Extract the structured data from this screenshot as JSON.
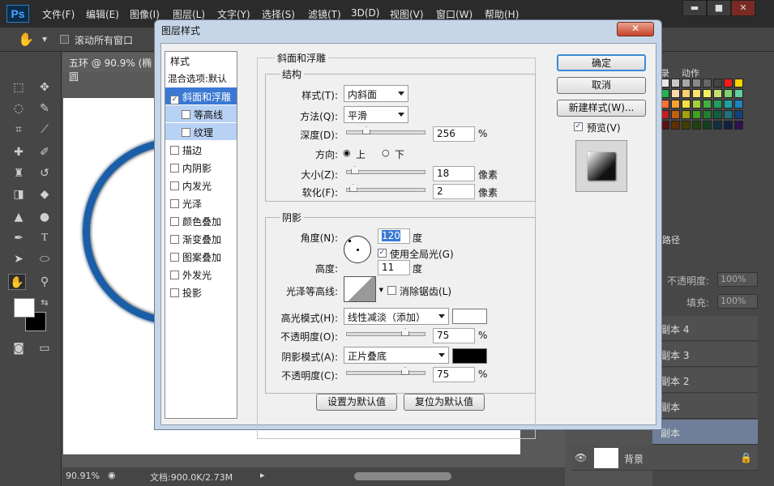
{
  "app": {
    "logo": "Ps",
    "menus": [
      "文件(F)",
      "编辑(E)",
      "图像(I)",
      "图层(L)",
      "文字(Y)",
      "选择(S)",
      "滤镜(T)",
      "3D(D)",
      "视图(V)",
      "窗口(W)",
      "帮助(H)"
    ],
    "window_buttons": [
      "▬",
      "■",
      "✕"
    ]
  },
  "options_bar": {
    "scroll_all": "滚动所有窗口"
  },
  "doc": {
    "tab": "五环 @ 90.9% (椭圆",
    "zoom": "90.91%",
    "doc_info": "文档:900.0K/2.73M"
  },
  "panels": {
    "tab_actions": "动作",
    "tab_record": "录",
    "tab_paths": "路径",
    "opacity_label": "不透明度:",
    "opacity_value": "100%",
    "fill_label": "填充:",
    "fill_value": "100%",
    "layers": [
      "副本 4",
      "副本 3",
      "副本 2",
      "副本",
      "副本",
      "背景"
    ]
  },
  "dialog": {
    "title": "图层样式",
    "close": "✕",
    "styles_header": "样式",
    "blend_options": "混合选项:默认",
    "style_items": [
      {
        "label": "斜面和浮雕",
        "checked": true
      },
      {
        "label": "等高线",
        "checked": false
      },
      {
        "label": "纹理",
        "checked": false
      },
      {
        "label": "描边",
        "checked": false
      },
      {
        "label": "内阴影",
        "checked": false
      },
      {
        "label": "内发光",
        "checked": false
      },
      {
        "label": "光泽",
        "checked": false
      },
      {
        "label": "颜色叠加",
        "checked": false
      },
      {
        "label": "渐变叠加",
        "checked": false
      },
      {
        "label": "图案叠加",
        "checked": false
      },
      {
        "label": "外发光",
        "checked": false
      },
      {
        "label": "投影",
        "checked": false
      }
    ],
    "bevel_title": "斜面和浮雕",
    "structure_title": "结构",
    "style_label": "样式(T):",
    "style_value": "内斜面",
    "method_label": "方法(Q):",
    "method_value": "平滑",
    "depth_label": "深度(D):",
    "depth_value": "256",
    "percent": "%",
    "direction_label": "方向:",
    "dir_up": "上",
    "dir_down": "下",
    "size_label": "大小(Z):",
    "size_value": "18",
    "px_unit": "像素",
    "soften_label": "软化(F):",
    "soften_value": "2",
    "shading_title": "阴影",
    "angle_label": "角度(N):",
    "angle_value": "120",
    "degree": "度",
    "global_light": "使用全局光(G)",
    "altitude_label": "高度:",
    "altitude_value": "11",
    "gloss_label": "光泽等高线:",
    "anti_alias": "消除锯齿(L)",
    "highlight_mode_label": "高光模式(H):",
    "highlight_mode_value": "线性减淡（添加）",
    "highlight_color": "#ffffff",
    "opacity_label": "不透明度(O):",
    "highlight_opacity": "75",
    "shadow_mode_label": "阴影模式(A):",
    "shadow_mode_value": "正片叠底",
    "shadow_color": "#000000",
    "shadow_opacity_label": "不透明度(C):",
    "shadow_opacity": "75",
    "make_default": "设置为默认值",
    "reset_default": "复位为默认值",
    "ok": "确定",
    "cancel": "取消",
    "new_style": "新建样式(W)...",
    "preview": "预览(V)",
    "slider_levels": {
      "depth": 0.25,
      "size": 0.1,
      "soften": 0.08,
      "highlight_opacity": 0.75,
      "shadow_opacity": 0.75
    }
  }
}
